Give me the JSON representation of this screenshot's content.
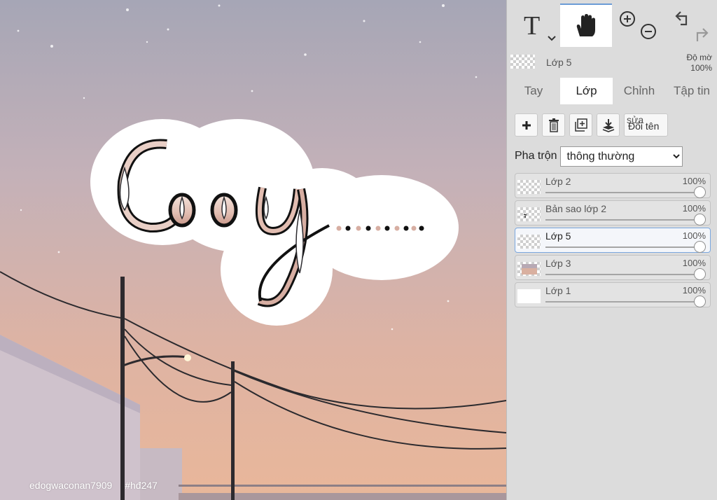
{
  "canvas": {
    "watermark_user": "edogwaconan7909",
    "watermark_tag": "#hđ247"
  },
  "toolbar": {
    "text_tool": "T",
    "tools": [
      "text-tool",
      "hand-tool",
      "zoom-tool",
      "undo-redo"
    ]
  },
  "current_layer": {
    "name": "Lớp 5",
    "opacity_label": "Độ mờ",
    "opacity_value": "100%"
  },
  "tabs": [
    "Tay",
    "Lớp",
    "Chỉnh",
    "Tập tin"
  ],
  "active_tab": "Lớp",
  "actions": {
    "add": "add-layer",
    "delete": "delete-layer",
    "duplicate": "duplicate-layer",
    "merge": "merge-down",
    "rename_top": "sửa",
    "rename_label": "Đổi tên"
  },
  "blend": {
    "label": "Pha trộn",
    "value": "thông thường"
  },
  "layers": [
    {
      "name": "Lớp 2",
      "opacity": "100%",
      "opacity_value": 1.0
    },
    {
      "name": "Bản sao lớp 2",
      "opacity": "100%",
      "opacity_value": 1.0
    },
    {
      "name": "Lớp 5",
      "opacity": "100%",
      "opacity_value": 1.0,
      "active": true
    },
    {
      "name": "Lớp 3",
      "opacity": "100%",
      "opacity_value": 1.0
    },
    {
      "name": "Lớp 1",
      "opacity": "100%",
      "opacity_value": 1.0
    }
  ],
  "colors": {
    "accent": "#6b9cd6",
    "panel_bg": "#dcdcdc",
    "sky_top": "#a9a6b4",
    "sky_bottom": "#e5b79f"
  }
}
